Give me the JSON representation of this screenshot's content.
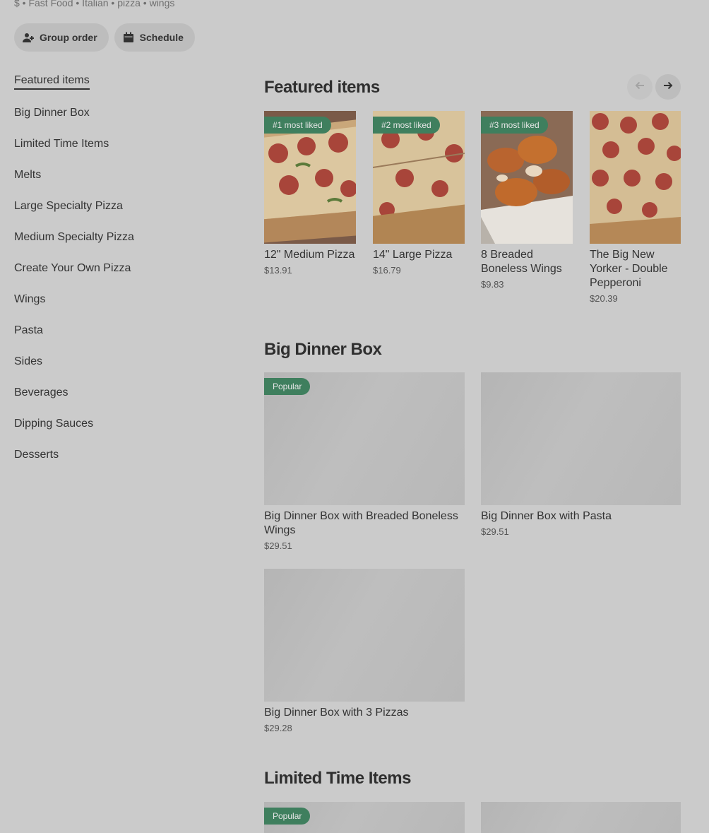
{
  "restaurant": {
    "tagline": "$ • Fast Food • Italian • pizza • wings"
  },
  "actions": {
    "group_order": "Group order",
    "schedule": "Schedule"
  },
  "sidebar": {
    "items": [
      {
        "label": "Featured items"
      },
      {
        "label": "Big Dinner Box"
      },
      {
        "label": "Limited Time Items"
      },
      {
        "label": "Melts"
      },
      {
        "label": "Large Specialty Pizza"
      },
      {
        "label": "Medium Specialty Pizza"
      },
      {
        "label": "Create Your Own Pizza"
      },
      {
        "label": "Wings"
      },
      {
        "label": "Pasta"
      },
      {
        "label": "Sides"
      },
      {
        "label": "Beverages"
      },
      {
        "label": "Dipping Sauces"
      },
      {
        "label": "Desserts"
      }
    ]
  },
  "featured": {
    "title": "Featured items",
    "items": [
      {
        "badge": "#1 most liked",
        "name": "12\" Medium Pizza",
        "price": "$13.91"
      },
      {
        "badge": "#2 most liked",
        "name": "14\" Large Pizza",
        "price": "$16.79"
      },
      {
        "badge": "#3 most liked",
        "name": "8 Breaded Boneless Wings",
        "price": "$9.83"
      },
      {
        "badge": "",
        "name": "The Big New Yorker - Double Pepperoni",
        "price": "$20.39"
      }
    ]
  },
  "big_dinner_box": {
    "title": "Big Dinner Box",
    "items": [
      {
        "badge": "Popular",
        "name": "Big Dinner Box with Breaded Boneless Wings",
        "price": "$29.51"
      },
      {
        "badge": "",
        "name": "Big Dinner Box with Pasta",
        "price": "$29.51"
      },
      {
        "badge": "",
        "name": "Big Dinner Box with 3 Pizzas",
        "price": "$29.28"
      }
    ]
  },
  "limited_time": {
    "title": "Limited Time Items",
    "items": [
      {
        "badge": "Popular"
      }
    ]
  },
  "colors": {
    "overlay_bg": "#cbcbcb",
    "badge_green": "#3f7f5e"
  }
}
